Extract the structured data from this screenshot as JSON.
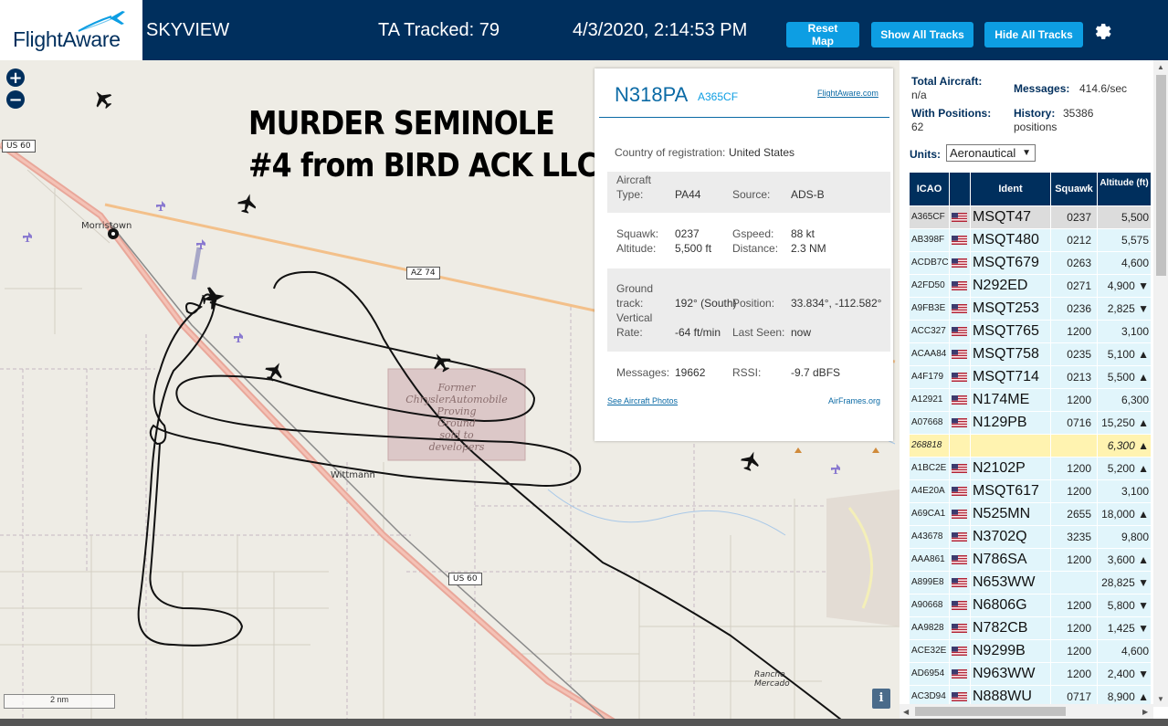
{
  "header": {
    "logo_text": "FlightAware",
    "site_name": "SKYVIEW",
    "tracked": "TA Tracked: 79",
    "datetime": "4/3/2020, 2:14:53 PM",
    "buttons": {
      "reset": "Reset Map",
      "show": "Show All Tracks",
      "hide": "Hide All Tracks"
    },
    "colors": {
      "bar": "#002f5d",
      "button": "#0d9ee3"
    }
  },
  "map": {
    "zoom_in": "+",
    "zoom_out": "−",
    "annotation_line1": "MURDER SEMINOLE",
    "annotation_line2": "#4 from BIRD ACK LLC",
    "labels": {
      "morristown": "Morristown",
      "wittmann": "Wittmann",
      "rancho": "Rancho Mercado"
    },
    "roads": {
      "us60_a": "US 60",
      "us60_b": "US 60",
      "az74": "AZ 74"
    },
    "area_label": [
      "Former",
      "ChryslerAutomobile",
      "Proving",
      "Ground",
      "sold to",
      "developers"
    ],
    "scale": "2 nm",
    "info": "i"
  },
  "selected": {
    "registration": "N318PA",
    "icao": "A365CF",
    "fa_link": "FlightAware.com",
    "country_label": "Country of registration:",
    "country": "United States",
    "type_label": "Aircraft Type:",
    "type_label_1": "Aircraft",
    "type_label_2": "Type:",
    "type": "PA44",
    "source_label": "Source:",
    "source": "ADS-B",
    "squawk_label": "Squawk:",
    "squawk": "0237",
    "gspeed_label": "Gspeed:",
    "gspeed": "88 kt",
    "altitude_label": "Altitude:",
    "altitude": "5,500 ft",
    "distance_label": "Distance:",
    "distance": "2.3 NM",
    "track_label_1": "Ground",
    "track_label_2": "track:",
    "track": "192° (South)",
    "position_label": "Position:",
    "position": "33.834°, -112.582°",
    "vrate_label_1": "Vertical",
    "vrate_label_2": "Rate:",
    "vrate": "-64 ft/min",
    "lastseen_label": "Last Seen:",
    "lastseen": "now",
    "messages_label": "Messages:",
    "messages": "19662",
    "rssi_label": "RSSI:",
    "rssi": "-9.7 dBFS",
    "photos_link": "See Aircraft Photos",
    "airframes_link": "AirFrames.org"
  },
  "sidebar": {
    "total_label": "Total Aircraft:",
    "total": "n/a",
    "messages_label": "Messages:",
    "messages": "414.6/sec",
    "positions_label": "With Positions:",
    "positions": "62",
    "history_label": "History:",
    "history": "35386 positions",
    "history_1": "35386",
    "history_2": "positions",
    "units_label": "Units:",
    "units": "Aeronautical",
    "columns": {
      "icao": "ICAO",
      "ident": "Ident",
      "squawk": "Squawk",
      "altitude": "Altitude (ft)"
    },
    "rows": [
      {
        "icao": "A365CF",
        "ident": "MSQT47",
        "squawk": "0237",
        "alt": "5,500"
      },
      {
        "icao": "AB398F",
        "ident": "MSQT480",
        "squawk": "0212",
        "alt": "5,575"
      },
      {
        "icao": "ACDB7C",
        "ident": "MSQT679",
        "squawk": "0263",
        "alt": "4,600"
      },
      {
        "icao": "A2FD50",
        "ident": "N292ED",
        "squawk": "0271",
        "alt": "4,900 ▼"
      },
      {
        "icao": "A9FB3E",
        "ident": "MSQT253",
        "squawk": "0236",
        "alt": "2,825 ▼"
      },
      {
        "icao": "ACC327",
        "ident": "MSQT765",
        "squawk": "1200",
        "alt": "3,100"
      },
      {
        "icao": "ACAA84",
        "ident": "MSQT758",
        "squawk": "0235",
        "alt": "5,100 ▲"
      },
      {
        "icao": "A4F179",
        "ident": "MSQT714",
        "squawk": "0213",
        "alt": "5,500 ▲"
      },
      {
        "icao": "A12921",
        "ident": "N174ME",
        "squawk": "1200",
        "alt": "6,300"
      },
      {
        "icao": "A07668",
        "ident": "N129PB",
        "squawk": "0716",
        "alt": "15,250 ▲"
      },
      {
        "icao": "268818",
        "ident": "",
        "squawk": "",
        "alt": "6,300 ▲"
      },
      {
        "icao": "A1BC2E",
        "ident": "N2102P",
        "squawk": "1200",
        "alt": "5,200 ▲"
      },
      {
        "icao": "A4E20A",
        "ident": "MSQT617",
        "squawk": "1200",
        "alt": "3,100"
      },
      {
        "icao": "A69CA1",
        "ident": "N525MN",
        "squawk": "2655",
        "alt": "18,000 ▲"
      },
      {
        "icao": "A43678",
        "ident": "N3702Q",
        "squawk": "3235",
        "alt": "9,800"
      },
      {
        "icao": "AAA861",
        "ident": "N786SA",
        "squawk": "1200",
        "alt": "3,600 ▲"
      },
      {
        "icao": "A899E8",
        "ident": "N653WW",
        "squawk": "",
        "alt": "28,825 ▼"
      },
      {
        "icao": "A90668",
        "ident": "N6806G",
        "squawk": "1200",
        "alt": "5,800 ▼"
      },
      {
        "icao": "AA9828",
        "ident": "N782CB",
        "squawk": "1200",
        "alt": "1,425 ▼"
      },
      {
        "icao": "ACE32E",
        "ident": "N9299B",
        "squawk": "1200",
        "alt": "4,600"
      },
      {
        "icao": "AD6954",
        "ident": "N963WW",
        "squawk": "1200",
        "alt": "2,400 ▼"
      },
      {
        "icao": "AC3D94",
        "ident": "N888WU",
        "squawk": "0717",
        "alt": "8,900 ▲"
      }
    ]
  }
}
